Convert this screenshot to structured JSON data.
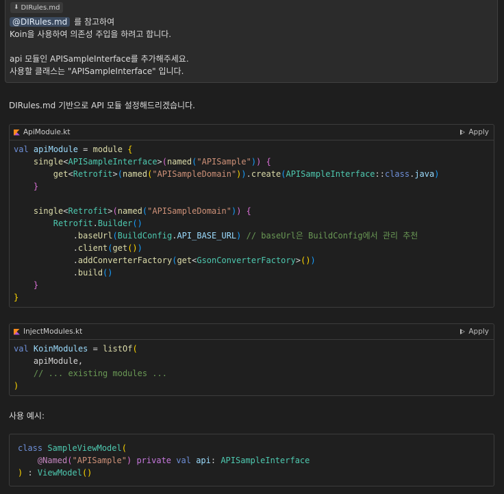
{
  "prompt": {
    "file_chip": "DIRules.md",
    "mention": "@DIRules.md",
    "line1_suffix": "를 참고하여",
    "line2": "Koin을 사용하여 의존성 주입을 하려고 합니다.",
    "line3": "api 모듈인 APISampleInterface를 추가해주세요.",
    "line4": "사용할 클래스는 \"APISampleInterface\" 입니다."
  },
  "response": {
    "intro": "DIRules.md 기반으로 API 모듈 설정해드리겠습니다.",
    "usage_label": "사용 예시:"
  },
  "cards": [
    {
      "filename": "ApiModule.kt",
      "apply_label": "Apply"
    },
    {
      "filename": "InjectModules.kt",
      "apply_label": "Apply"
    }
  ],
  "code": {
    "api_module": [
      "val apiModule = module {",
      "    single<APISampleInterface>(named(\"APISample\")) {",
      "        get<Retrofit>(named(\"APISampleDomain\")).create(APISampleInterface::class.java)",
      "    }",
      "",
      "    single<Retrofit>(named(\"APISampleDomain\")) {",
      "        Retrofit.Builder()",
      "            .baseUrl(BuildConfig.API_BASE_URL) // baseUrl은 BuildConfig에서 관리 추천",
      "            .client(get())",
      "            .addConverterFactory(get<GsonConverterFactory>())",
      "            .build()",
      "    }",
      "}"
    ],
    "inject_modules": [
      "val KoinModules = listOf(",
      "    apiModule,",
      "    // ... existing modules ...",
      ")"
    ],
    "usage": [
      "class SampleViewModel(",
      "    @Named(\"APISample\") private val api: APISampleInterface",
      ") : ViewModel()"
    ]
  },
  "icons": {
    "file_chip": "pin-icon",
    "card": "kotlin-file-icon",
    "apply": "play-icon"
  },
  "colors": {
    "background": "#1e1e1e",
    "keyword": "#c678dd",
    "type": "#4ec9b0",
    "string": "#ce9178",
    "comment": "#6a9955"
  }
}
